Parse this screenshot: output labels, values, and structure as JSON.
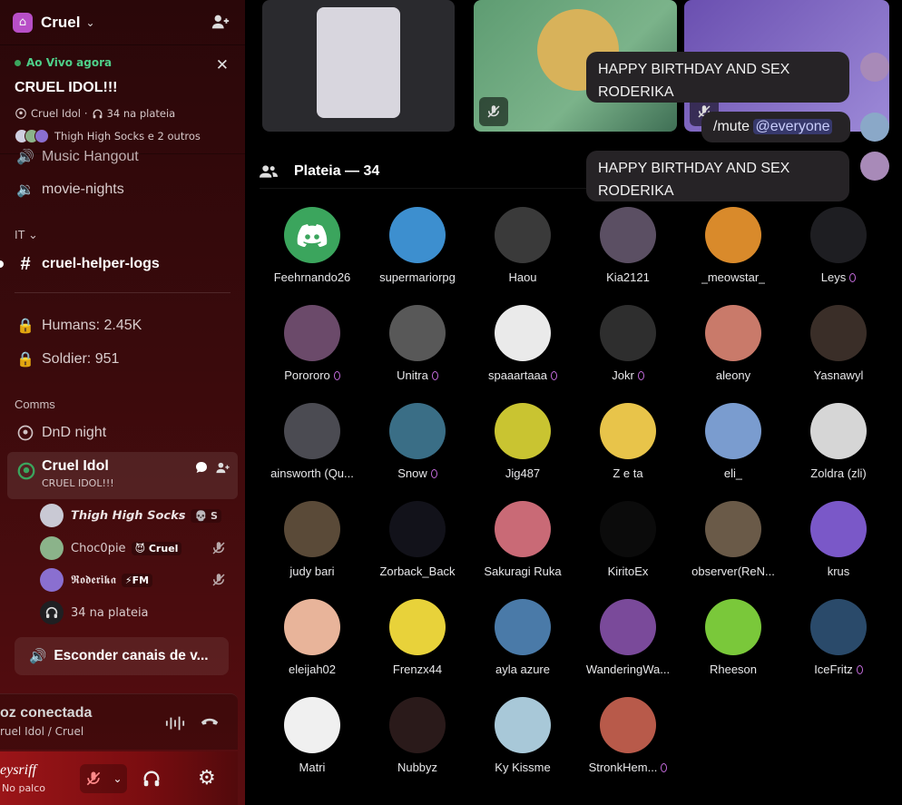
{
  "server": {
    "name": "Cruel",
    "chevron": "⌄"
  },
  "live_card": {
    "status": "Ao Vivo agora",
    "title": "CRUEL IDOL!!!",
    "host": "Cruel Idol",
    "audience": "34 na plateia",
    "speakers_text": "Thigh High Socks e 2 outros",
    "close_glyph": "✕"
  },
  "channels": {
    "music": "Music Hangout",
    "movie": "movie-nights",
    "category_it": "IT",
    "helper_logs": "cruel-helper-logs",
    "humans": "Humans: 2.45K",
    "soldier": "Soldier: 951",
    "category_comms": "Comms",
    "dnd": "DnD night"
  },
  "active_channel": {
    "name": "Cruel Idol",
    "topic": "CRUEL IDOL!!!"
  },
  "voice_users": [
    {
      "name": "𝙏𝙝𝙞𝙜𝙝 𝙃𝙞𝙜𝙝 𝙎𝙤𝙘𝙠𝙨",
      "tag": "💀 S",
      "color": "#c9c9d4"
    },
    {
      "name": "Choc0pie",
      "tag": "😈 Cruel",
      "color": "#8bb38a"
    },
    {
      "name": "𝕽𝖔𝖉𝖊𝖗𝖎𝖐𝖆",
      "tag": "⚡FM",
      "color": "#8a6fd0"
    }
  ],
  "audience_row_label": "34 na plateia",
  "hide_button": "Esconder canais de v...",
  "voice_panel": {
    "status": "oz conectada",
    "location": "ruel Idol / Cruel"
  },
  "user_panel": {
    "name": "eysriff",
    "status": "No palco"
  },
  "audience": {
    "label": "Plateia — 34"
  },
  "members": [
    {
      "name": "Feehrnando26",
      "color": "#3ba55d",
      "badge": false
    },
    {
      "name": "supermariorpg",
      "color": "#3d8fcf",
      "badge": false
    },
    {
      "name": "Haou",
      "color": "#3a3a3a",
      "badge": false
    },
    {
      "name": "Kia2121",
      "color": "#5b4f63",
      "badge": false
    },
    {
      "name": "_meowstar_",
      "color": "#d98a2b",
      "badge": false
    },
    {
      "name": "Leys",
      "color": "#1e1e22",
      "badge": true
    },
    {
      "name": "Porororo",
      "color": "#6b4a6a",
      "badge": true
    },
    {
      "name": "Unitra",
      "color": "#585858",
      "badge": true
    },
    {
      "name": "spaaartaaa",
      "color": "#eaeaea",
      "badge": true
    },
    {
      "name": "Jokr",
      "color": "#2e2e2e",
      "badge": true
    },
    {
      "name": "aleony",
      "color": "#c97a6a",
      "badge": false
    },
    {
      "name": "Yasnawyl",
      "color": "#3a2e28",
      "badge": false
    },
    {
      "name": "ainsworth (Qu...",
      "color": "#4b4b52",
      "badge": false
    },
    {
      "name": "Snow",
      "color": "#3a6e86",
      "badge": true
    },
    {
      "name": "Jig487",
      "color": "#c9c431",
      "badge": false
    },
    {
      "name": "Z e ta",
      "color": "#e8c44a",
      "badge": false
    },
    {
      "name": "eli_",
      "color": "#7a9ccf",
      "badge": false
    },
    {
      "name": "Zoldra (zli)",
      "color": "#d6d6d6",
      "badge": false
    },
    {
      "name": "judy bari",
      "color": "#5a4a38",
      "badge": false
    },
    {
      "name": "Zorback_Back",
      "color": "#12121a",
      "badge": false
    },
    {
      "name": "Sakuragi Ruka",
      "color": "#c96a76",
      "badge": false
    },
    {
      "name": "KiritoEx",
      "color": "#0b0b0b",
      "badge": false
    },
    {
      "name": "observer(ReN...",
      "color": "#6a5a48",
      "badge": false
    },
    {
      "name": "krus",
      "color": "#7a58c8",
      "badge": false
    },
    {
      "name": "eleijah02",
      "color": "#e8b49a",
      "badge": false
    },
    {
      "name": "Frenzx44",
      "color": "#e8d23a",
      "badge": false
    },
    {
      "name": "ayla azure",
      "color": "#4a7aa8",
      "badge": false
    },
    {
      "name": "WanderingWa...",
      "color": "#7a4a9a",
      "badge": false
    },
    {
      "name": "Rheeson",
      "color": "#7ac83a",
      "badge": false
    },
    {
      "name": "IceFritz",
      "color": "#2a4a6a",
      "badge": true
    },
    {
      "name": "Matri",
      "color": "#f0f0f0",
      "badge": false
    },
    {
      "name": "Nubbyz",
      "color": "#2a1a1a",
      "badge": false
    },
    {
      "name": "Ky Kissme",
      "color": "#a8c8d8",
      "badge": false
    },
    {
      "name": "StronkHem...",
      "color": "#b85a4a",
      "badge": true
    }
  ],
  "chat_bubbles": [
    {
      "text": "HAPPY BIRTHDAY AND SEX RODERIKA"
    },
    {
      "text_prefix": "/mute ",
      "mention": "@everyone"
    },
    {
      "text": "HAPPY BIRTHDAY AND SEX RODERIKA"
    }
  ],
  "colors": {
    "accent_live": "#3ba55d",
    "sidebar_bg": "#3a0a0c",
    "user_panel": "#9b1518"
  }
}
